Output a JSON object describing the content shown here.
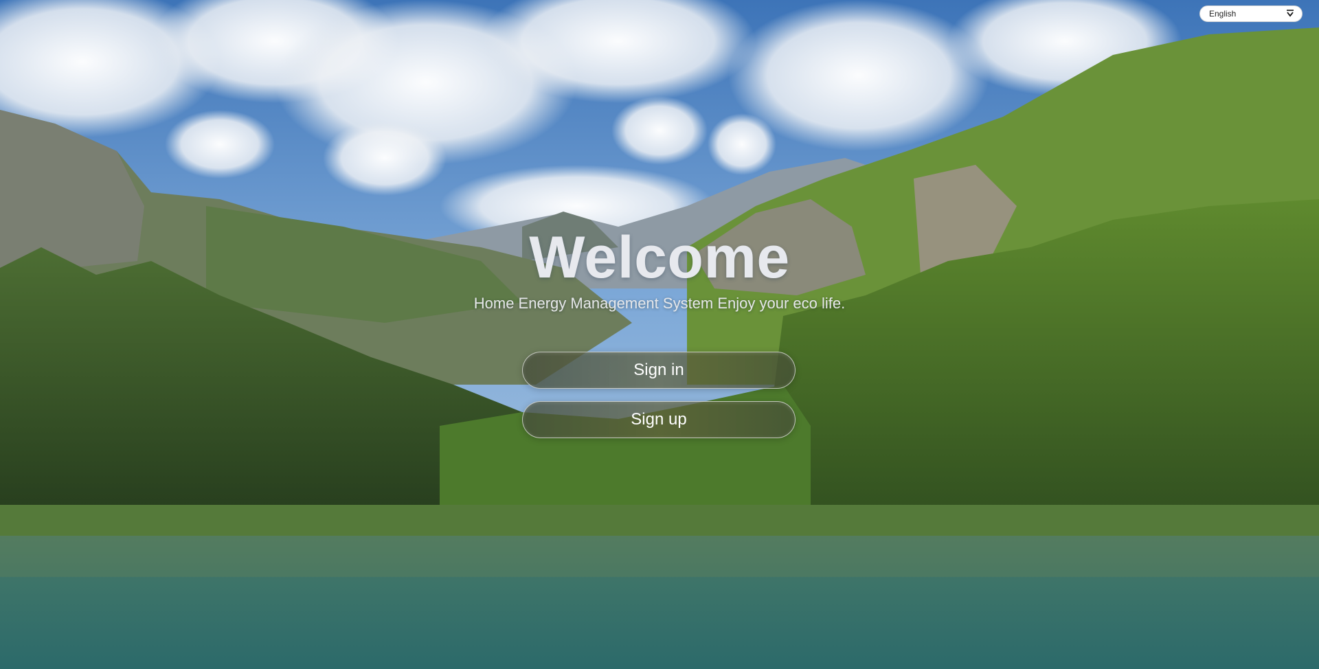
{
  "language": {
    "selected": "English"
  },
  "hero": {
    "title": "Welcome",
    "subtitle": "Home Energy Management System Enjoy your eco life."
  },
  "actions": {
    "sign_in_label": "Sign in",
    "sign_up_label": "Sign up"
  },
  "colors": {
    "title_text": "#e7e9ee",
    "button_text": "#ffffff",
    "button_border": "#ffffff"
  },
  "icons": {
    "language_dropdown": "chevron-down-icon"
  }
}
